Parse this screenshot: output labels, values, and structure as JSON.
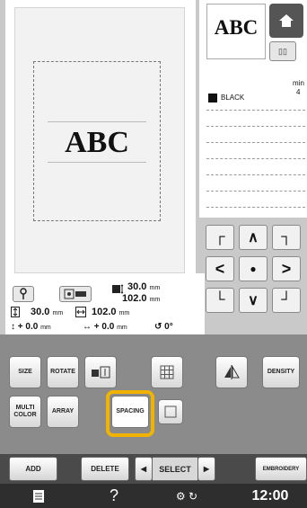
{
  "design": {
    "text": "ABC"
  },
  "preview": {
    "text": "ABC",
    "hoop_label": "▯▯"
  },
  "color": {
    "name": "BLACK",
    "swatch": "#111111",
    "min_label": "min",
    "min_value": "4"
  },
  "arrows": {
    "up_left": "┌",
    "up": "∧",
    "up_right": "┐",
    "left": "<",
    "center": "●",
    "right": ">",
    "down_left": "└",
    "down": "∨",
    "down_right": "┘"
  },
  "size_info": {
    "height_val": "30.0",
    "height_unit": "mm",
    "width_val": "102.0",
    "width_unit": "mm",
    "row2_h": "30.0",
    "row2_h_unit": "mm",
    "row2_w": "102.0",
    "row2_w_unit": "mm",
    "offset_v": "0.0",
    "offset_v_unit": "mm",
    "offset_h": "0.0",
    "offset_h_unit": "mm",
    "angle": "0°"
  },
  "buttons": {
    "size": "SIZE",
    "rotate": "ROTATE",
    "density": "DENSITY",
    "multi_color": "MULTI COLOR",
    "array": "ARRAY",
    "spacing": "SPACING"
  },
  "bottom": {
    "add": "ADD",
    "delete": "DELETE",
    "select": "SELECT",
    "embroidery": "EMBROIDERY"
  },
  "status": {
    "time": "12:00",
    "help": "?"
  },
  "colors": {
    "highlight": "#f0b400"
  }
}
